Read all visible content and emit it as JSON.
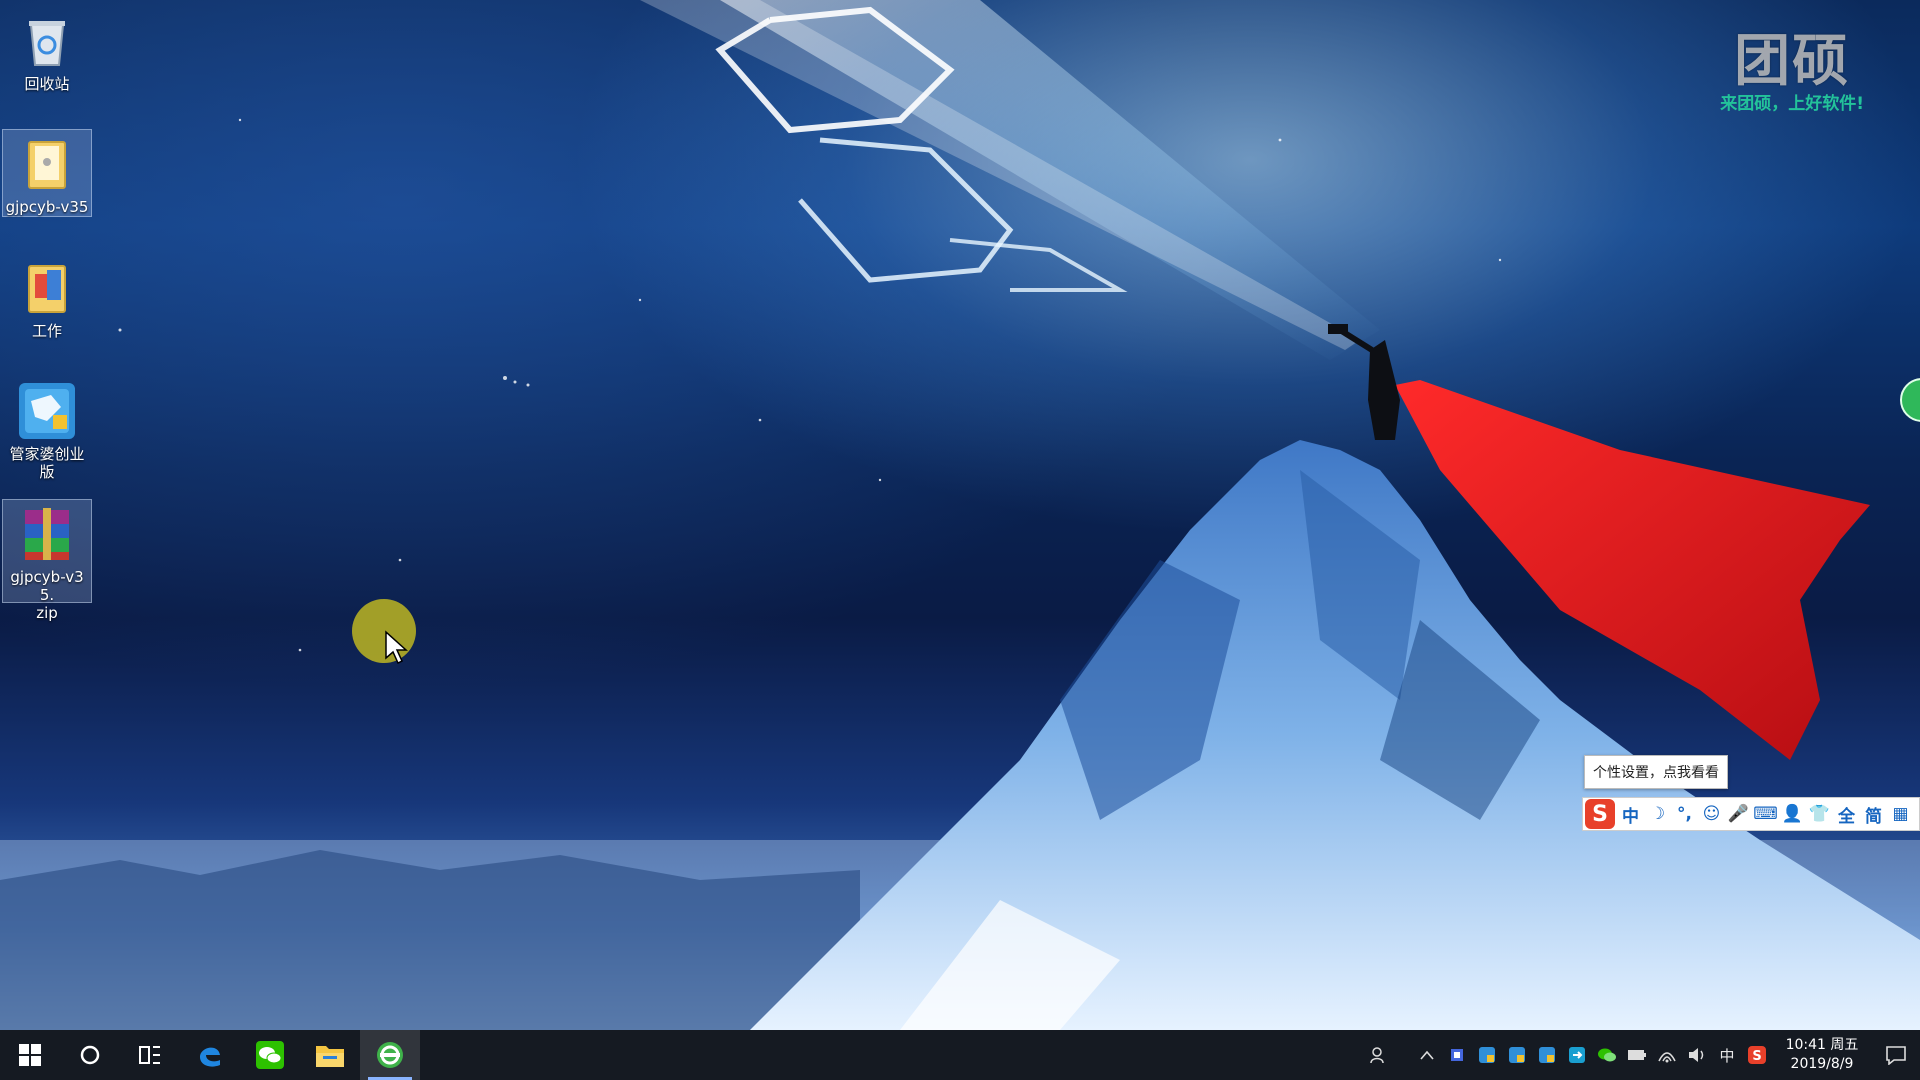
{
  "desktop": {
    "icons": [
      {
        "label": "回收站",
        "icon": "recycle-bin-icon"
      },
      {
        "label": "gjpcyb-v35",
        "icon": "folder-icon"
      },
      {
        "label": "工作",
        "icon": "folder-document-icon"
      },
      {
        "label": "管家婆创业版",
        "icon": "guanjiapo-app-icon"
      },
      {
        "label": "gjpcyb-v35.\nzip",
        "icon": "winrar-archive-icon"
      }
    ]
  },
  "watermark": {
    "brand": "团硕",
    "slogan": "来团硕，上好软件!"
  },
  "ime": {
    "tooltip": "个性设置，点我看看",
    "buttons": [
      {
        "icon": "sogou-logo-icon",
        "text": "S"
      },
      {
        "icon": "chinese-mode-icon",
        "text": "中"
      },
      {
        "icon": "half-width-moon-icon",
        "text": "☽"
      },
      {
        "icon": "punctuation-icon",
        "text": "°,"
      },
      {
        "icon": "emoji-icon",
        "text": "☺"
      },
      {
        "icon": "microphone-icon",
        "text": "🎤"
      },
      {
        "icon": "keyboard-icon",
        "text": "⌨"
      },
      {
        "icon": "user-icon",
        "text": "👤"
      },
      {
        "icon": "skin-shirt-icon",
        "text": "👕"
      },
      {
        "icon": "full-width-icon",
        "text": "全"
      },
      {
        "icon": "simplified-icon",
        "text": "简"
      },
      {
        "icon": "toolbox-grid-icon",
        "text": "▦"
      }
    ]
  },
  "taskbar": {
    "apps": [
      {
        "icon": "edge-browser-icon",
        "running": false
      },
      {
        "icon": "wechat-icon",
        "running": false
      },
      {
        "icon": "file-explorer-icon",
        "running": false
      },
      {
        "icon": "360-browser-icon",
        "running": true
      }
    ],
    "tray": {
      "language": "中",
      "time": "10:41 周五",
      "date": "2019/8/9"
    }
  },
  "colors": {
    "taskbar": "#151a22",
    "cape_red": "#e0151a",
    "watermark_green": "#23c39a"
  }
}
